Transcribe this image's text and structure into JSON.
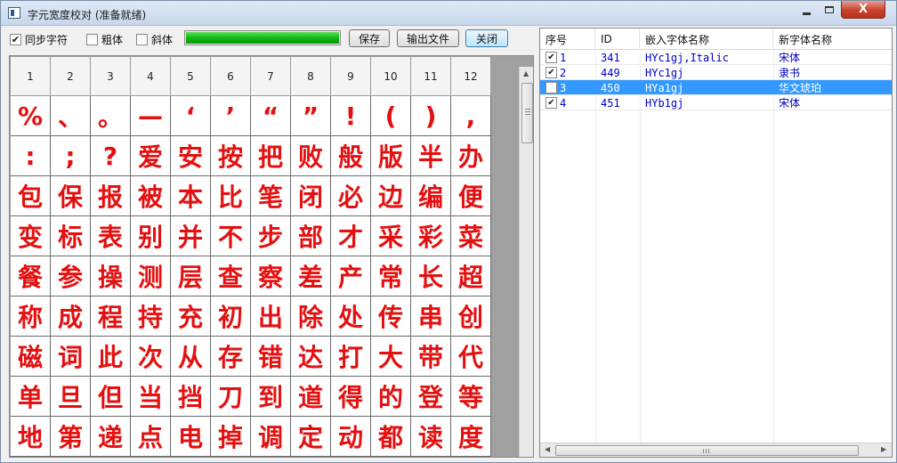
{
  "window": {
    "title": "字元宽度校对 (准备就绪)",
    "minimize": "",
    "maximize": "",
    "close": "X"
  },
  "toolbar": {
    "sync_label": "同步字符",
    "sync_checked": true,
    "bold_label": "粗体",
    "bold_checked": false,
    "italic_label": "斜体",
    "italic_checked": false,
    "progress": 1.0,
    "save_label": "保存",
    "export_label": "输出文件",
    "close_label": "关闭"
  },
  "grid": {
    "columns": [
      "1",
      "2",
      "3",
      "4",
      "5",
      "6",
      "7",
      "8",
      "9",
      "10",
      "11",
      "12"
    ],
    "rows": [
      [
        "%",
        "、",
        "。",
        "—",
        "‘",
        "’",
        "“",
        "”",
        "!",
        "(",
        ")",
        ","
      ],
      [
        ":",
        ";",
        "?",
        "爱",
        "安",
        "按",
        "把",
        "败",
        "般",
        "版",
        "半",
        "办"
      ],
      [
        "包",
        "保",
        "报",
        "被",
        "本",
        "比",
        "笔",
        "闭",
        "必",
        "边",
        "编",
        "便"
      ],
      [
        "变",
        "标",
        "表",
        "别",
        "并",
        "不",
        "步",
        "部",
        "才",
        "采",
        "彩",
        "菜"
      ],
      [
        "餐",
        "参",
        "操",
        "测",
        "层",
        "查",
        "察",
        "差",
        "产",
        "常",
        "长",
        "超"
      ],
      [
        "称",
        "成",
        "程",
        "持",
        "充",
        "初",
        "出",
        "除",
        "处",
        "传",
        "串",
        "创"
      ],
      [
        "磁",
        "词",
        "此",
        "次",
        "从",
        "存",
        "错",
        "达",
        "打",
        "大",
        "带",
        "代"
      ],
      [
        "单",
        "旦",
        "但",
        "当",
        "挡",
        "刀",
        "到",
        "道",
        "得",
        "的",
        "登",
        "等"
      ],
      [
        "地",
        "第",
        "递",
        "点",
        "电",
        "掉",
        "调",
        "定",
        "动",
        "都",
        "读",
        "度"
      ]
    ]
  },
  "list": {
    "headers": [
      "序号",
      "ID",
      "嵌入字体名称",
      "新字体名称"
    ],
    "rows": [
      {
        "checked": true,
        "seq": "1",
        "id": "341",
        "embedded": "HYc1gj,Italic",
        "newfont": "宋体",
        "selected": false
      },
      {
        "checked": true,
        "seq": "2",
        "id": "449",
        "embedded": "HYc1gj",
        "newfont": "隶书",
        "selected": false
      },
      {
        "checked": false,
        "seq": "3",
        "id": "450",
        "embedded": "HYa1gj",
        "newfont": "华文琥珀",
        "selected": true
      },
      {
        "checked": true,
        "seq": "4",
        "id": "451",
        "embedded": "HYb1gj",
        "newfont": "宋体",
        "selected": false
      }
    ]
  },
  "colors": {
    "glyph": "#e41010",
    "selection": "#3399ff",
    "list_text": "#0000c8",
    "progress": "#12b612"
  }
}
